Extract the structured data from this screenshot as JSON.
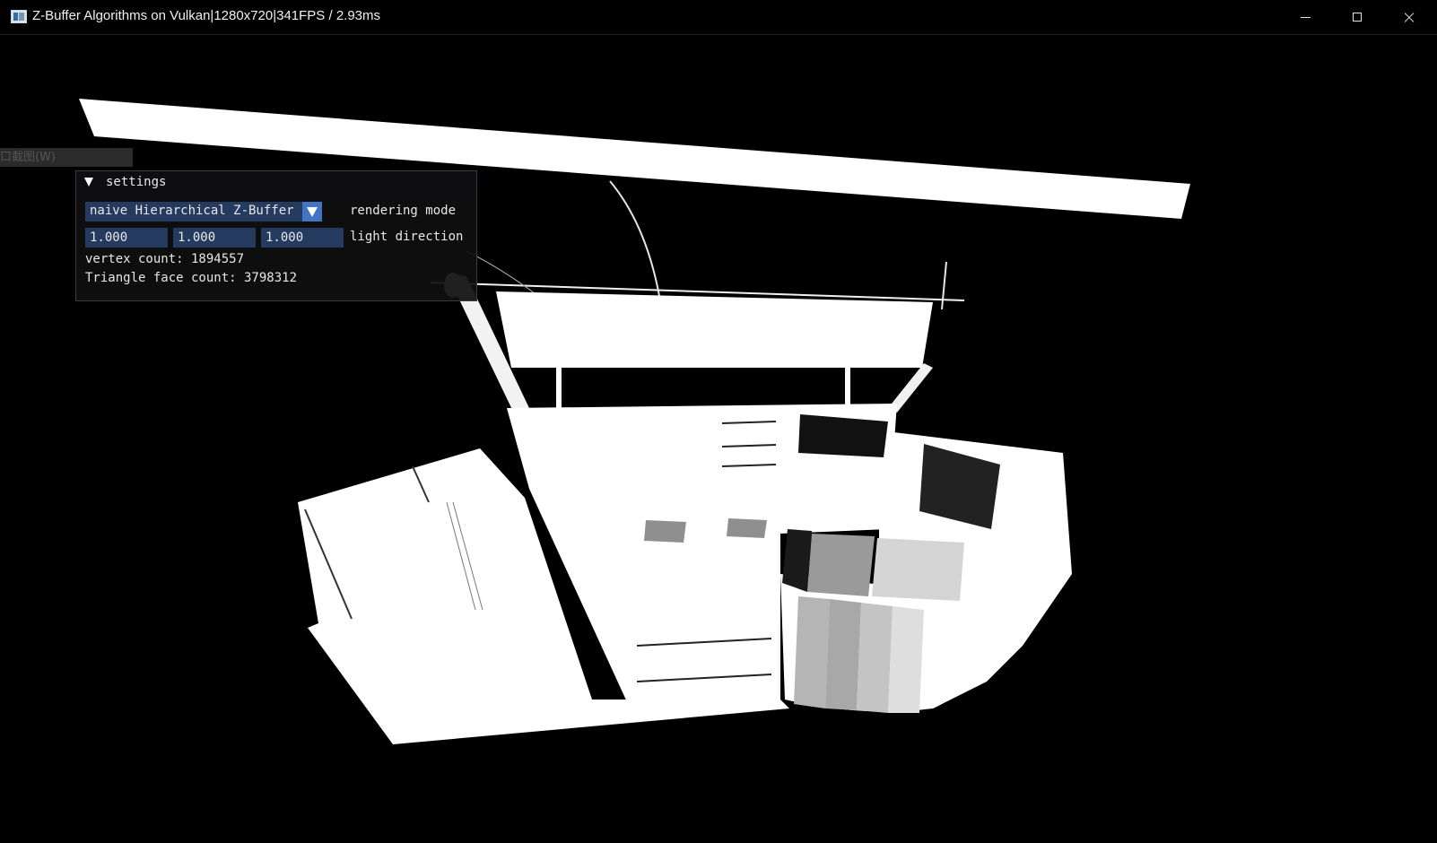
{
  "window": {
    "title": "Z-Buffer Algorithms on Vulkan|1280x720|341FPS / 2.93ms",
    "icon": "app-window-icon",
    "controls": [
      "minimize-icon",
      "maximize-icon",
      "close-icon"
    ]
  },
  "ghost_tab_label": "口截图(W)",
  "settings": {
    "title": "settings",
    "rendering_mode": {
      "selected": "naive Hierarchical Z-Buffer",
      "label": "rendering mode"
    },
    "light_direction": {
      "x": "1.000",
      "y": "1.000",
      "z": "1.000",
      "label": "light direction"
    },
    "vertex_count_text": "vertex count: 1894557",
    "triangle_count_text": "Triangle face count: 3798312"
  },
  "colors": {
    "background": "#000000",
    "frame_bg": "#243a5e",
    "combo_button": "#4274c4",
    "window_bg": "#0f0f0f",
    "mesh": "#ffffff"
  }
}
